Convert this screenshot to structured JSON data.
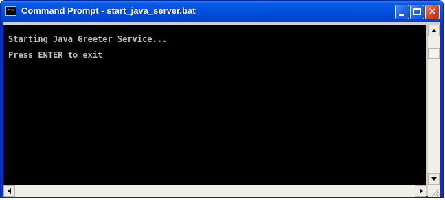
{
  "window": {
    "title": "Command Prompt - start_java_server.bat",
    "icon_label": "C:\\",
    "icon": "console-window-icon",
    "title_color": "#0053e0",
    "close_color": "#d6482b"
  },
  "console": {
    "background": "#000000",
    "text_color": "#c0c0c0",
    "lines": [
      "Starting Java Greeter Service...",
      "Press ENTER to exit"
    ]
  },
  "controls": {
    "minimize_icon": "minimize-icon",
    "maximize_icon": "maximize-icon",
    "close_icon": "close-icon"
  },
  "scrollbars": {
    "vertical": {
      "up_icon": "scroll-up-arrow-icon",
      "down_icon": "scroll-down-arrow-icon"
    },
    "horizontal": {
      "left_icon": "scroll-left-arrow-icon",
      "right_icon": "scroll-right-arrow-icon"
    }
  }
}
